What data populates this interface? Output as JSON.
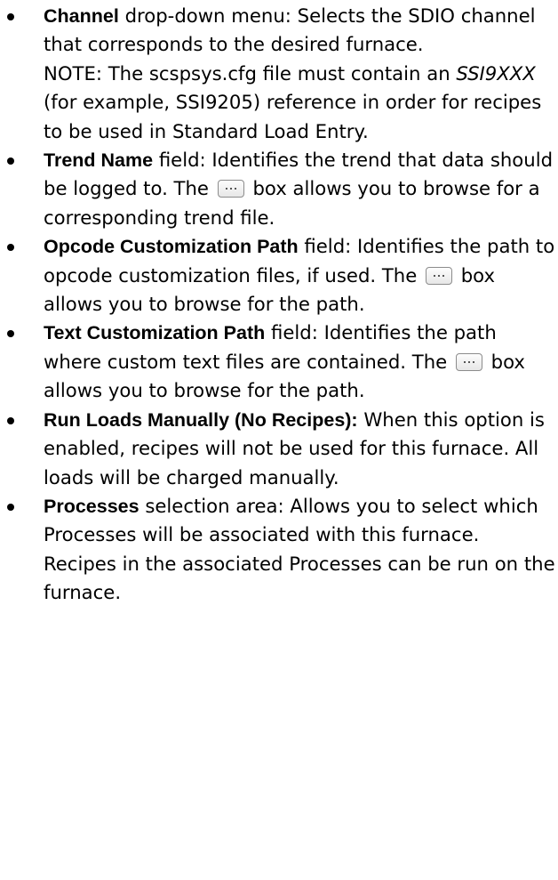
{
  "items": [
    {
      "term": "Channel",
      "text": " drop-down menu: Selects the SDIO channel that corresponds to the desired furnace.",
      "note_prefix": "NOTE: The scspsys.cfg file must contain an ",
      "note_em": "SSI9XXX",
      "note_suffix": " (for example, SSI9205) reference in order for recipes to be used in Standard Load Entry."
    },
    {
      "term": "Trend Name",
      "text_before": " field: Identifies the trend that data should be logged to. The ",
      "text_after": " box allows you to browse for a corresponding trend file."
    },
    {
      "term": "Opcode Customization Path",
      "text_before": " field: Identifies the path to opcode customization files, if used. The ",
      "text_after": " box allows you to browse for the path."
    },
    {
      "term": "Text Customization Path",
      "text_before": " field: Identifies the path where custom text files are contained. The ",
      "text_after": " box allows you to browse for the path."
    },
    {
      "term": "Run Loads Manually (No Recipes):",
      "text": " When this option is enabled, recipes will not be used for this furnace. All loads will be charged manually."
    },
    {
      "term": "Processes",
      "text": " selection area: Allows you to select which Processes will be associated with this furnace. Recipes in the associated Processes can be run on the furnace."
    }
  ],
  "icons": {
    "browse": "ellipsis-browse-button-icon"
  }
}
